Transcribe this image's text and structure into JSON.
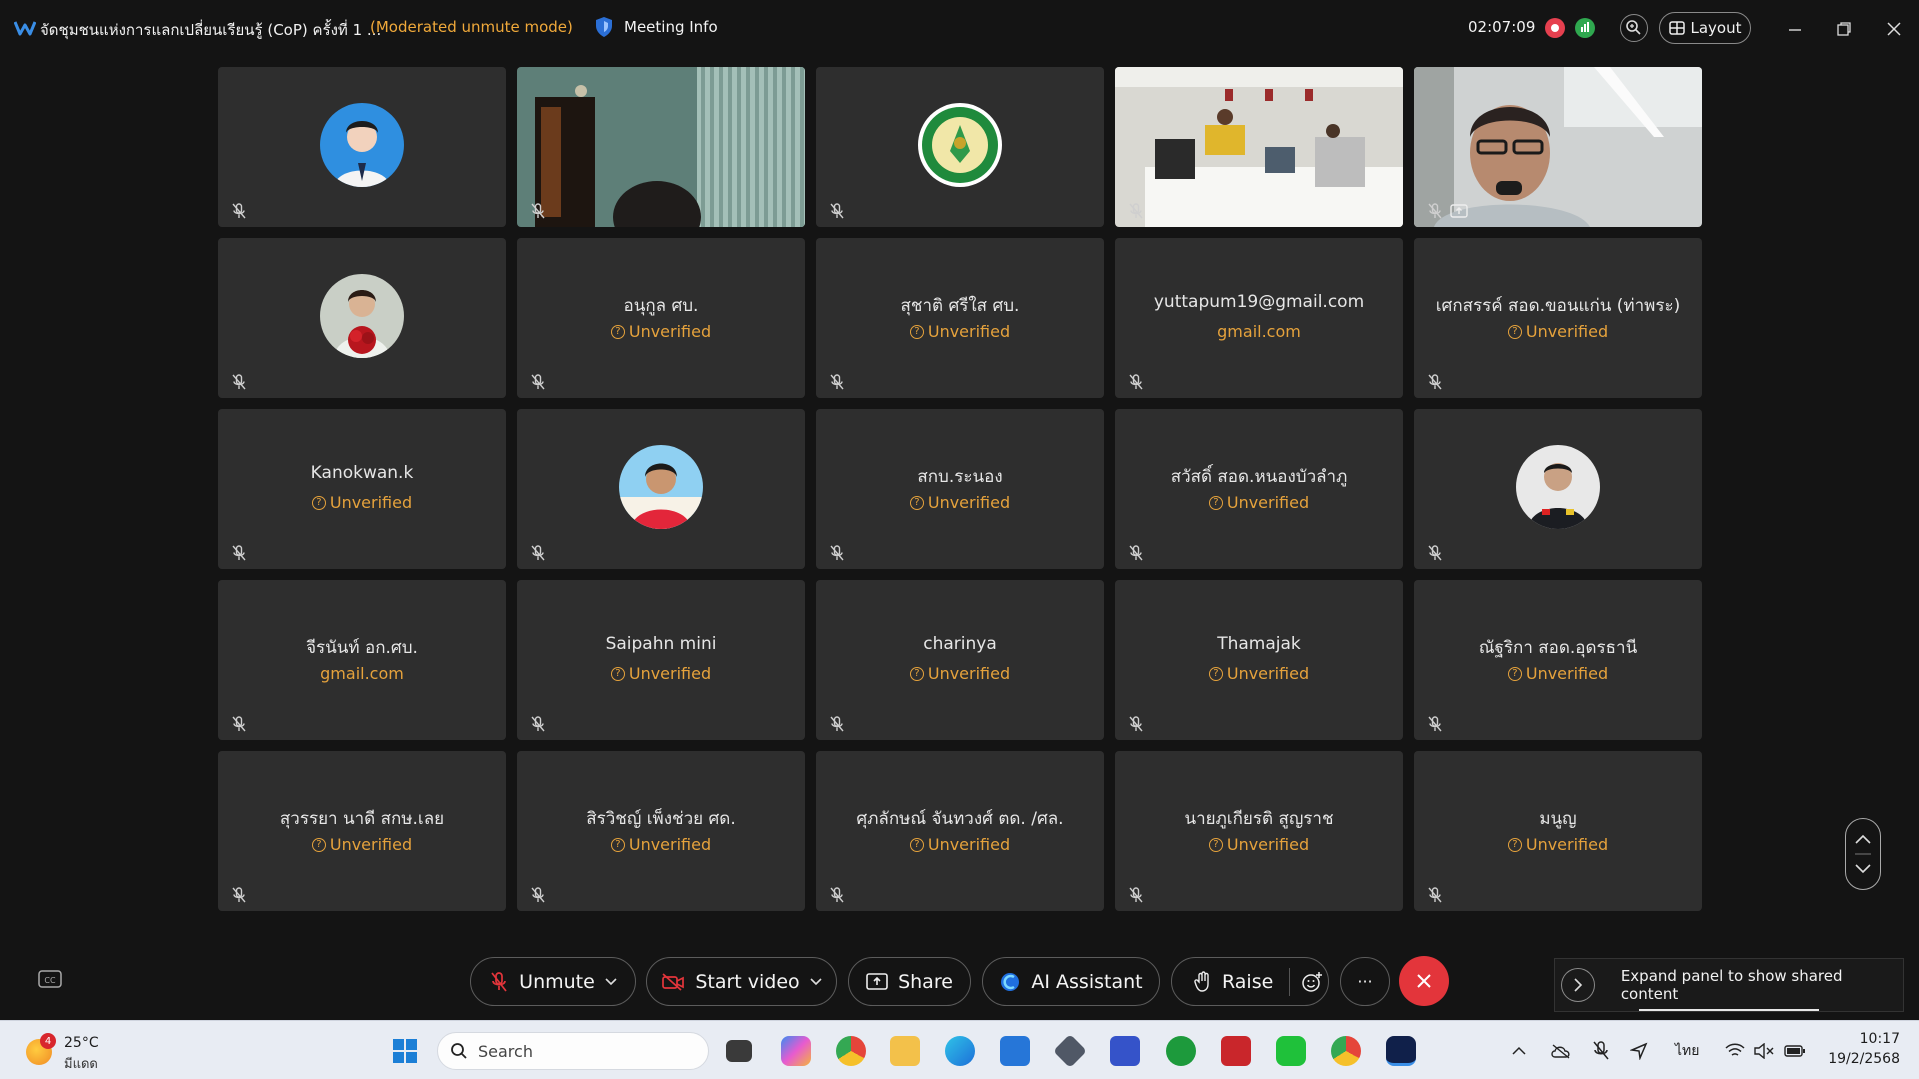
{
  "titlebar": {
    "title": "จัดชุมชนแห่งการแลกเปลี่ยนเรียนรู้ (CoP) ครั้งที่ 1 ...",
    "mode": "(Moderated unmute mode)",
    "meeting_info": "Meeting Info",
    "timer": "02:07:09",
    "layout": "Layout"
  },
  "colors": {
    "accent_orange": "#f0a93a",
    "end_red": "#e3353b",
    "tile_bg": "#2e2e2e"
  },
  "tiles": [
    {
      "kind": "avatar",
      "icon": "person-photo-1"
    },
    {
      "kind": "video",
      "icon": "camera-feed-office"
    },
    {
      "kind": "avatar",
      "icon": "department-logo"
    },
    {
      "kind": "video",
      "icon": "camera-feed-meeting-room"
    },
    {
      "kind": "video",
      "icon": "camera-feed-speaker",
      "sharing": true
    },
    {
      "kind": "avatar",
      "icon": "person-photo-2"
    },
    {
      "kind": "name",
      "name": "อนุกูล ศบ.",
      "status": "Unverified"
    },
    {
      "kind": "name",
      "name": "สุชาติ ศรีใส ศบ.",
      "status": "Unverified"
    },
    {
      "kind": "name",
      "name": "yuttapum19@gmail.com",
      "status": "gmail.com"
    },
    {
      "kind": "name",
      "name": "เศกสรรค์ สอด.ขอนแก่น (ท่าพระ)",
      "status": "Unverified"
    },
    {
      "kind": "name",
      "name": "Kanokwan.k",
      "status": "Unverified"
    },
    {
      "kind": "avatar",
      "icon": "person-photo-3"
    },
    {
      "kind": "name",
      "name": "สกบ.ระนอง",
      "status": "Unverified"
    },
    {
      "kind": "name",
      "name": "สวัสดิ์ สอด.หนองบัวลำภู",
      "status": "Unverified"
    },
    {
      "kind": "avatar",
      "icon": "person-photo-4"
    },
    {
      "kind": "name",
      "name": "จีรนันท์ อก.ศบ.",
      "status": "gmail.com"
    },
    {
      "kind": "name",
      "name": "Saipahn mini",
      "status": "Unverified"
    },
    {
      "kind": "name",
      "name": "charinya",
      "status": "Unverified"
    },
    {
      "kind": "name",
      "name": "Thamajak",
      "status": "Unverified"
    },
    {
      "kind": "name",
      "name": "ณัฐริกา สอด.อุดรธานี",
      "status": "Unverified"
    },
    {
      "kind": "name",
      "name": "สุวรรยา นาดี สกษ.เลย",
      "status": "Unverified"
    },
    {
      "kind": "name",
      "name": "สิรวิชญ์ เพ็งช่วย ศด.",
      "status": "Unverified"
    },
    {
      "kind": "name",
      "name": "ศุภลักษณ์ จันทวงศ์ ตด. /ศล.",
      "status": "Unverified"
    },
    {
      "kind": "name",
      "name": "นายภูเกียรติ สูญราช",
      "status": "Unverified"
    },
    {
      "kind": "name",
      "name": "มนูญ",
      "status": "Unverified"
    }
  ],
  "toolbar": {
    "unmute": "Unmute",
    "start_video": "Start video",
    "share": "Share",
    "ai_assistant": "AI Assistant",
    "raise": "Raise",
    "more": "···",
    "expand_panel": "Expand panel to show shared content"
  },
  "taskbar": {
    "weather_badge": "4",
    "temperature": "25°C",
    "condition": "มีแดด",
    "search": "Search",
    "language": "ไทย",
    "time": "10:17",
    "date": "19/2/2568"
  }
}
